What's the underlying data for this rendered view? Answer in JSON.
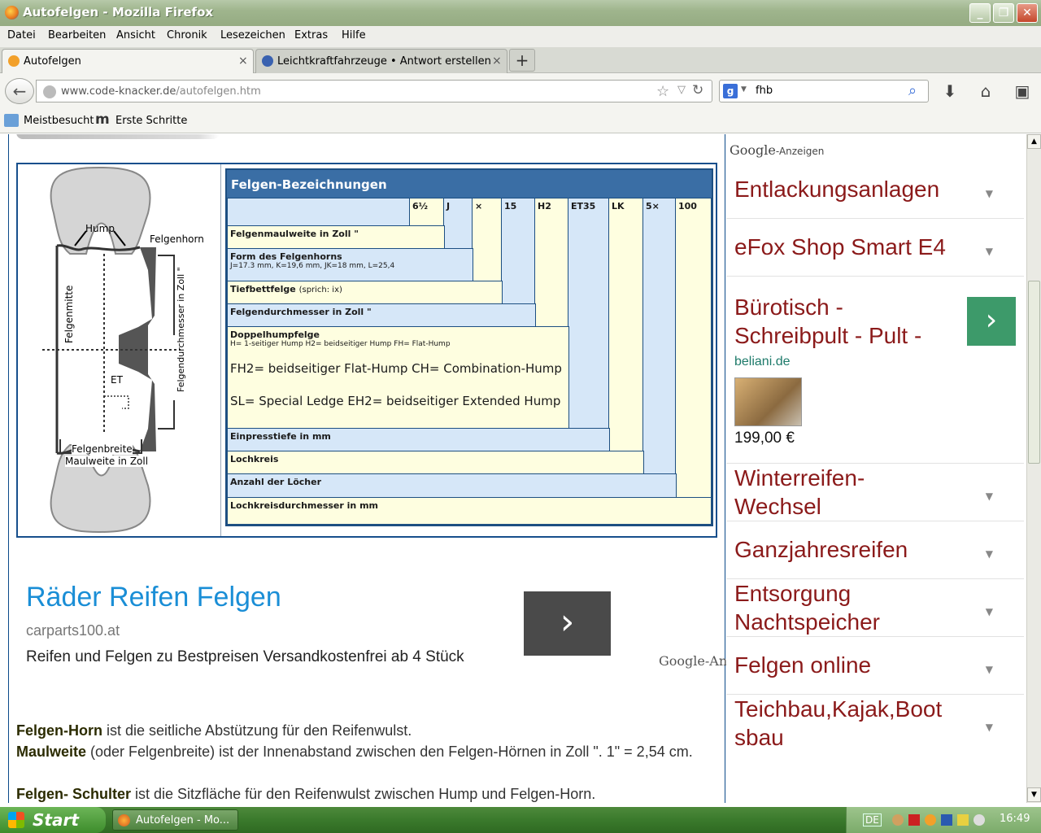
{
  "window": {
    "title": "Autofelgen - Mozilla Firefox"
  },
  "menu": [
    "Datei",
    "Bearbeiten",
    "Ansicht",
    "Chronik",
    "Lesezeichen",
    "Extras",
    "Hilfe"
  ],
  "tabs": [
    {
      "label": "Autofelgen",
      "close": "×"
    },
    {
      "label": "Leichtkraftfahrzeuge • Antwort erstellen",
      "close": "×"
    }
  ],
  "newtab": "+",
  "nav": {
    "url_host": "www.code-knacker.de",
    "url_path": "/autofelgen.htm",
    "search_value": "fhb",
    "search_engine": "g"
  },
  "bookmarks": [
    "Meistbesucht",
    "Erste Schritte"
  ],
  "figure": {
    "labels": {
      "hump": "Hump",
      "felgenhorn": "Felgenhorn",
      "felgenmitte": "Felgenmitte",
      "durchmesser": "Felgendurchmesser in Zoll \"",
      "et": "ET",
      "felgenbreite": "Felgenbreite",
      "maulweite": "Maulweite in Zoll"
    },
    "table_title": "Felgen-Bezeichnungen",
    "codes": [
      "6½",
      "J",
      "×",
      "15",
      "H2",
      "ET35",
      "LK",
      "5×",
      "100"
    ],
    "rows": {
      "r1": "Felgenmaulweite in Zoll \"",
      "r2": "Form des Felgenhorns",
      "r2s": "J=17.3 mm, K=19,6 mm, JK=18 mm, L=25,4",
      "r3": "Tiefbettfelge",
      "r3s": "(sprich: ix)",
      "r4": "Felgendurchmesser in Zoll \"",
      "r5": "Doppelhumpfelge",
      "r5s": "H= 1-seitiger Hump  H2= beidseitiger Hump   FH= Flat-Hump",
      "r5b1": "FH2= beidseitiger Flat-Hump   CH= Combination-Hump",
      "r5b2": "SL= Special Ledge   EH2= beidseitiger Extended Hump",
      "r6": "Einpresstiefe in mm",
      "r7": "Lochkreis",
      "r8": "Anzahl der Löcher",
      "r9": "Lochkreisdurchmesser in mm"
    }
  },
  "ad": {
    "title": "Räder Reifen Felgen",
    "url": "carparts100.at",
    "desc": "Reifen und Felgen zu Bestpreisen Versandkostenfrei ab 4 Stück",
    "button": "›",
    "google": "Google-An"
  },
  "text": {
    "p1b": "Felgen-Horn",
    "p1": " ist die seitliche Abstützung für den Reifenwulst.",
    "p2b": "Maulweite",
    "p2": " (oder Felgenbreite) ist der Innenabstand zwischen den Felgen-Hörnen in Zoll \".  1\" = 2,54 cm.",
    "p3b": "Felgen- Schulter",
    "p3": " ist die Sitzfläche für den Reifenwulst zwischen Hump und Felgen-Horn."
  },
  "sidebar": {
    "google_label": "Google",
    "anzeigen": "-Anzeigen",
    "items": [
      {
        "label": "Entlackungsanlagen"
      },
      {
        "label": "eFox Shop Smart E4"
      },
      {
        "label": "Bürotisch - Schreibpult - Pult -"
      },
      {
        "label": "Winterreifen- Wechsel"
      },
      {
        "label": "Ganzjahresreifen"
      },
      {
        "label": "Entsorgung Nachtspeicher"
      },
      {
        "label": "Felgen online"
      },
      {
        "label": "Teichbau,Kajak,Boot sbau"
      }
    ],
    "featured": {
      "domain": "beliani.de",
      "price": "199,00 €",
      "button": "›"
    }
  },
  "taskbar": {
    "start": "Start",
    "task": "Autofelgen - Mo...",
    "lang": "DE",
    "clock": "16:49"
  }
}
